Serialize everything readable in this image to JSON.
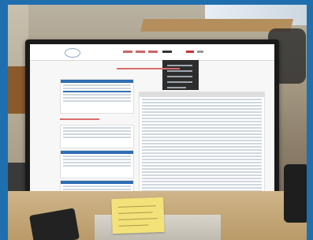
{
  "scene": {
    "description_items": [
      "monitor",
      "webpage-with-tables",
      "dropdown-menu",
      "sticky-note",
      "headset"
    ]
  },
  "colors": {
    "frame_blue": "#1f6fae",
    "page_blue": "#2f6db3",
    "page_red": "#d86c6c",
    "note_yellow": "#f3e27a"
  }
}
